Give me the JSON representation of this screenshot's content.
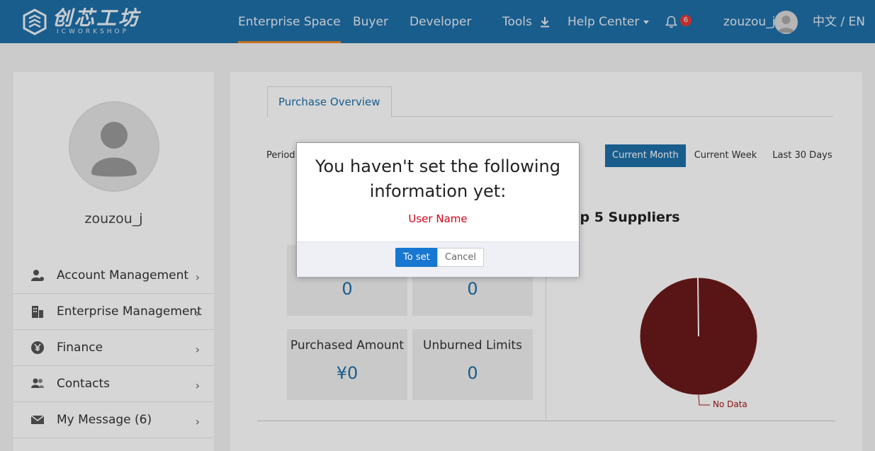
{
  "header": {
    "logo": {
      "cn": "创芯工坊",
      "en": "ICWORKSHOP"
    },
    "nav": [
      {
        "label": "Enterprise Space"
      },
      {
        "label": "Buyer"
      },
      {
        "label": "Developer"
      },
      {
        "label": "Tools"
      },
      {
        "label": "Help Center"
      }
    ],
    "notifications_count": "6",
    "username": "zouzou_j",
    "language": "中文 / EN"
  },
  "sidebar": {
    "username": "zouzou_j",
    "items": [
      {
        "label": "Account Management",
        "icon": "user-gear-icon"
      },
      {
        "label": "Enterprise Management",
        "icon": "building-icon"
      },
      {
        "label": "Finance",
        "icon": "yen-icon"
      },
      {
        "label": "Contacts",
        "icon": "contacts-icon"
      },
      {
        "label": "My Message (6)",
        "icon": "envelope-icon"
      }
    ]
  },
  "main": {
    "tab": "Purchase Overview",
    "period_label": "Period",
    "period_options": [
      {
        "label": "Current Month",
        "active": true
      },
      {
        "label": "Current Week",
        "active": false
      },
      {
        "label": "Last 30 Days",
        "active": false
      }
    ],
    "chart_title": "Top 5 Suppliers",
    "stats": [
      {
        "label": "",
        "value": "0"
      },
      {
        "label": "",
        "value": "0"
      },
      {
        "label": "Purchased Amount",
        "value": "¥0"
      },
      {
        "label": "Unburned Limits",
        "value": "0"
      }
    ],
    "pie": {
      "label": "No Data",
      "color": "#6b1a1a"
    }
  },
  "modal": {
    "title": "You haven't set the following information yet:",
    "item": "User Name",
    "confirm_label": "To set",
    "cancel_label": "Cancel"
  },
  "colors": {
    "header_bg": "#1e6fa8",
    "accent": "#1e6fa8",
    "nav_active_underline": "#e8872a",
    "badge": "#e53935",
    "warning_text": "#d0021b"
  }
}
